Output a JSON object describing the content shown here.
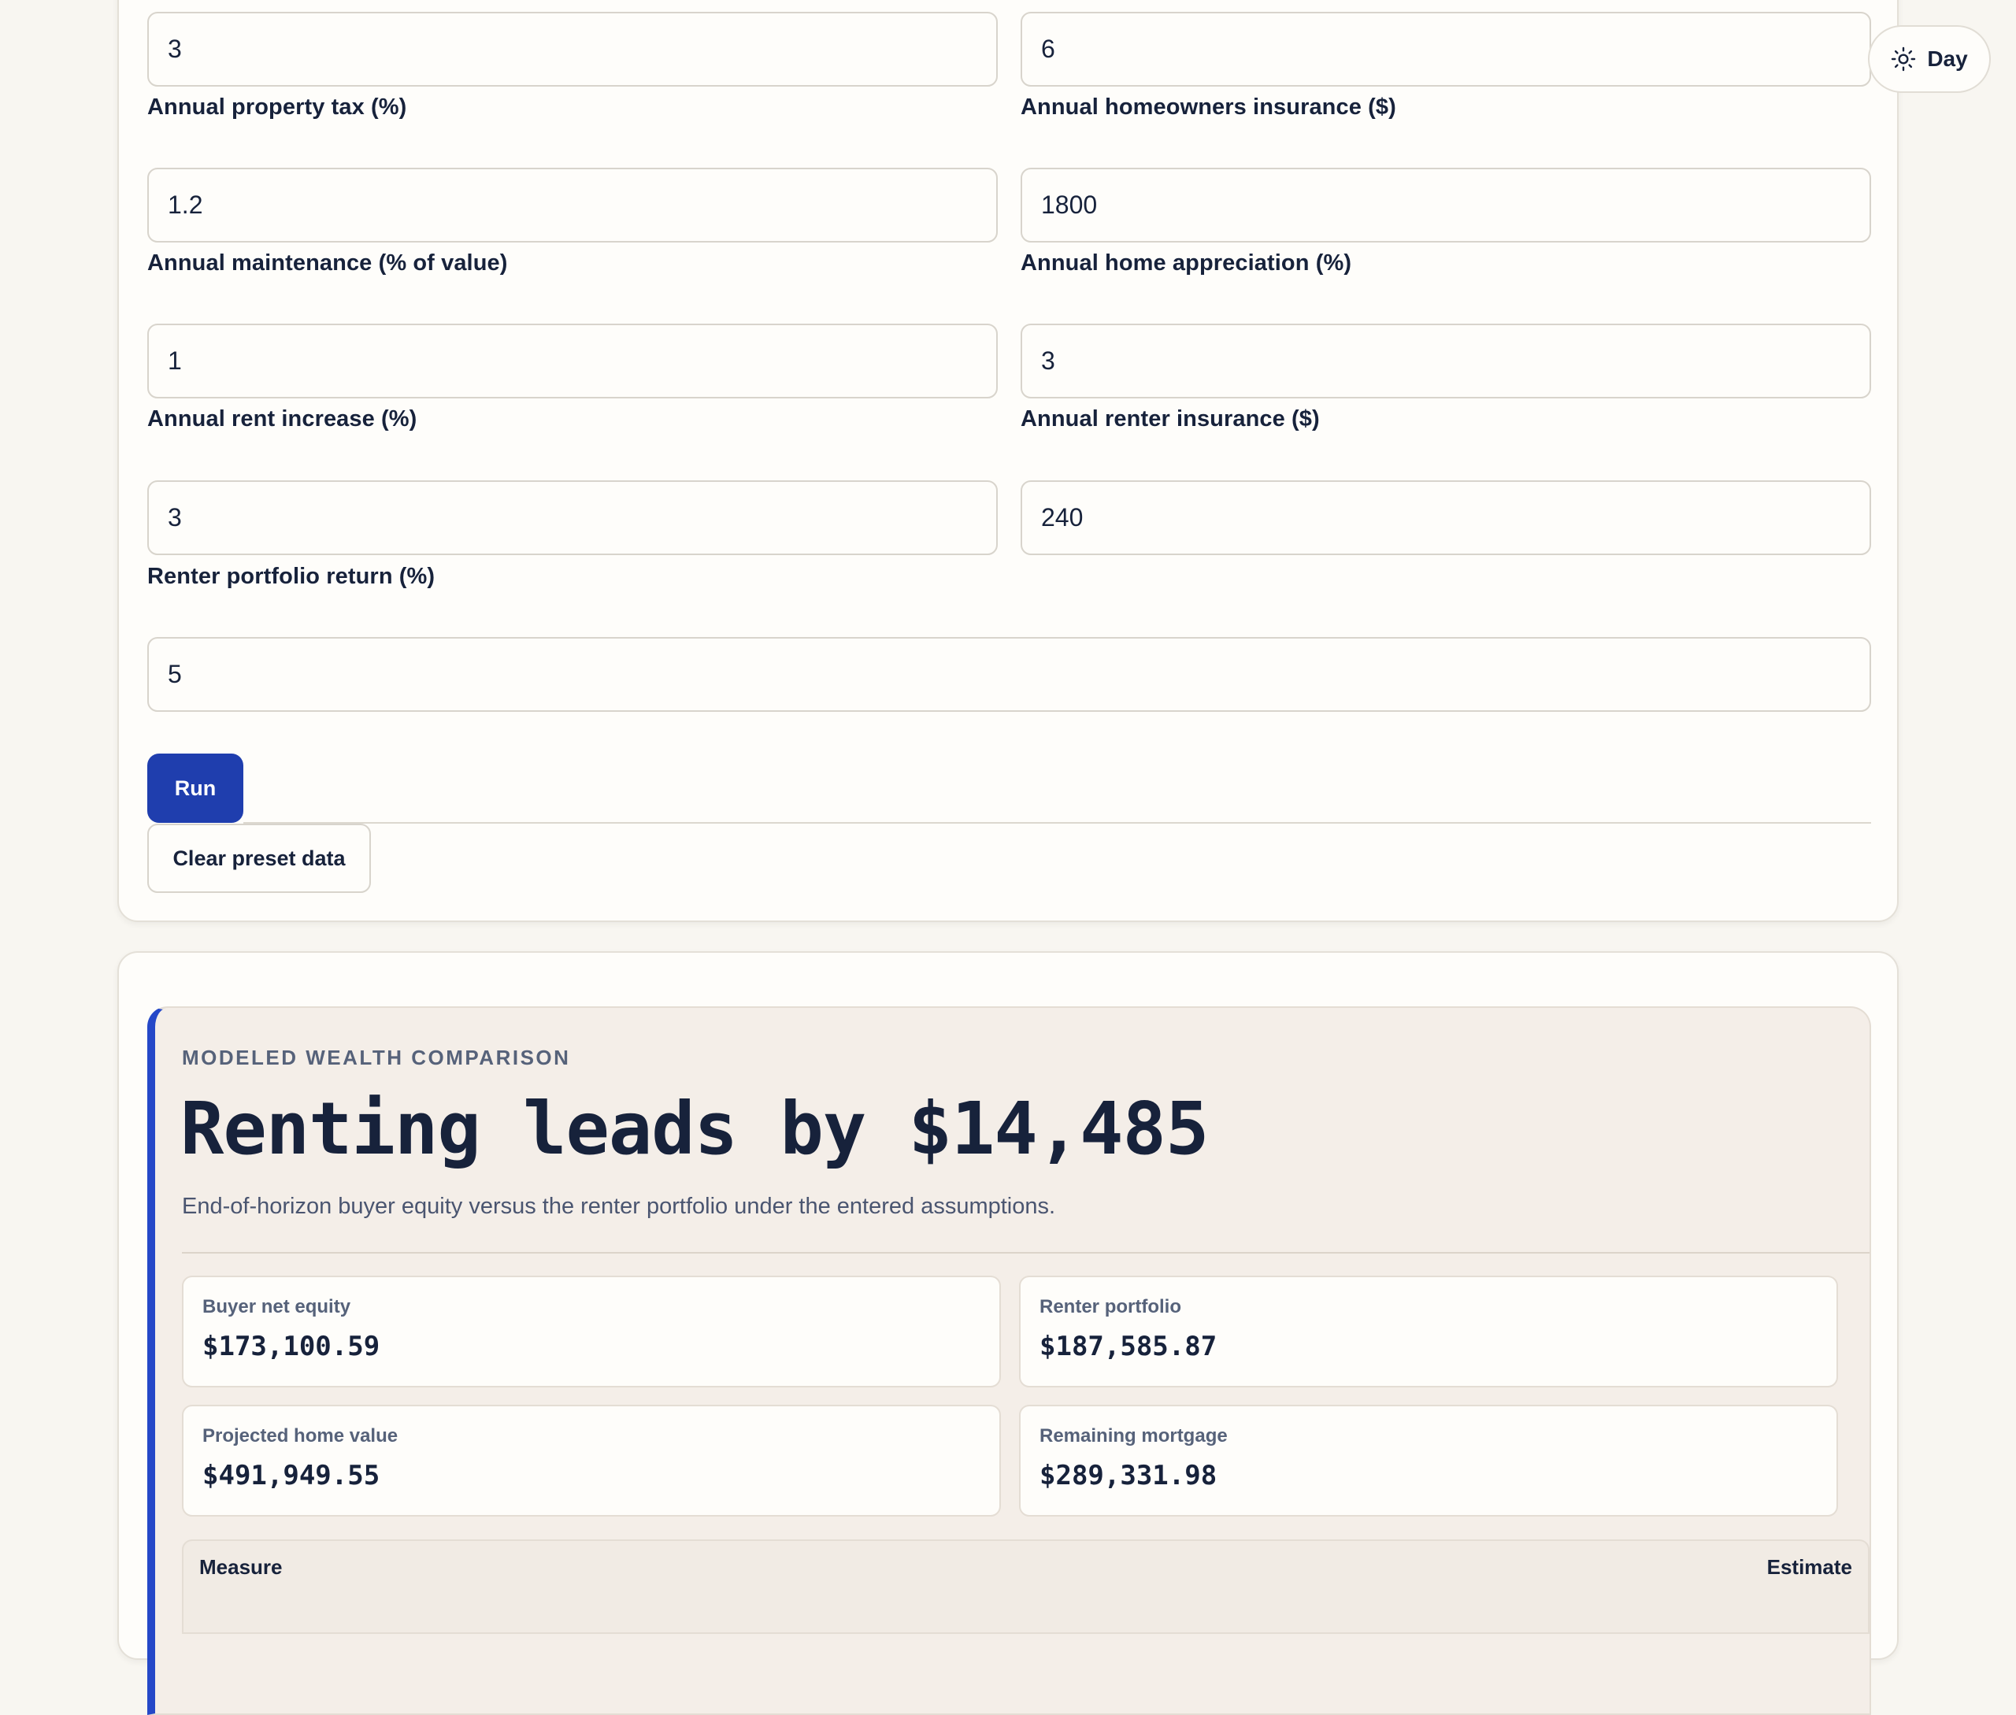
{
  "form": {
    "row0": {
      "left_value": "3",
      "right_value": "6"
    },
    "fields": {
      "property_tax": {
        "label": "Annual property tax (%)",
        "value": "1.2"
      },
      "homeowners_insurance": {
        "label": "Annual homeowners insurance ($)",
        "value": "1800"
      },
      "maintenance": {
        "label": "Annual maintenance (% of value)",
        "value": "1"
      },
      "appreciation": {
        "label": "Annual home appreciation (%)",
        "value": "3"
      },
      "rent_increase": {
        "label": "Annual rent increase (%)",
        "value": "3"
      },
      "renter_insurance": {
        "label": "Annual renter insurance ($)",
        "value": "240"
      },
      "portfolio_return": {
        "label": "Renter portfolio return (%)",
        "value": "5"
      }
    },
    "run_label": "Run",
    "clear_label": "Clear preset data"
  },
  "theme_toggle": {
    "label": "Day",
    "icon": "sun-icon"
  },
  "summary": {
    "eyebrow": "MODELED WEALTH COMPARISON",
    "headline": "Renting leads by $14,485",
    "description": "End-of-horizon buyer equity versus the renter portfolio under the entered assumptions.",
    "metrics": {
      "buyer_equity": {
        "label": "Buyer net equity",
        "value": "$173,100.59"
      },
      "renter_portfolio": {
        "label": "Renter portfolio",
        "value": "$187,585.87"
      },
      "home_value": {
        "label": "Projected home value",
        "value": "$491,949.55"
      },
      "remaining_mortgage": {
        "label": "Remaining mortgage",
        "value": "$289,331.98"
      }
    },
    "table": {
      "col_measure": "Measure",
      "col_estimate": "Estimate"
    }
  },
  "colors": {
    "accent": "#1f3eae",
    "accent_bar": "#2548c8",
    "page_bg": "#f8f6f1",
    "text": "#17223b"
  }
}
